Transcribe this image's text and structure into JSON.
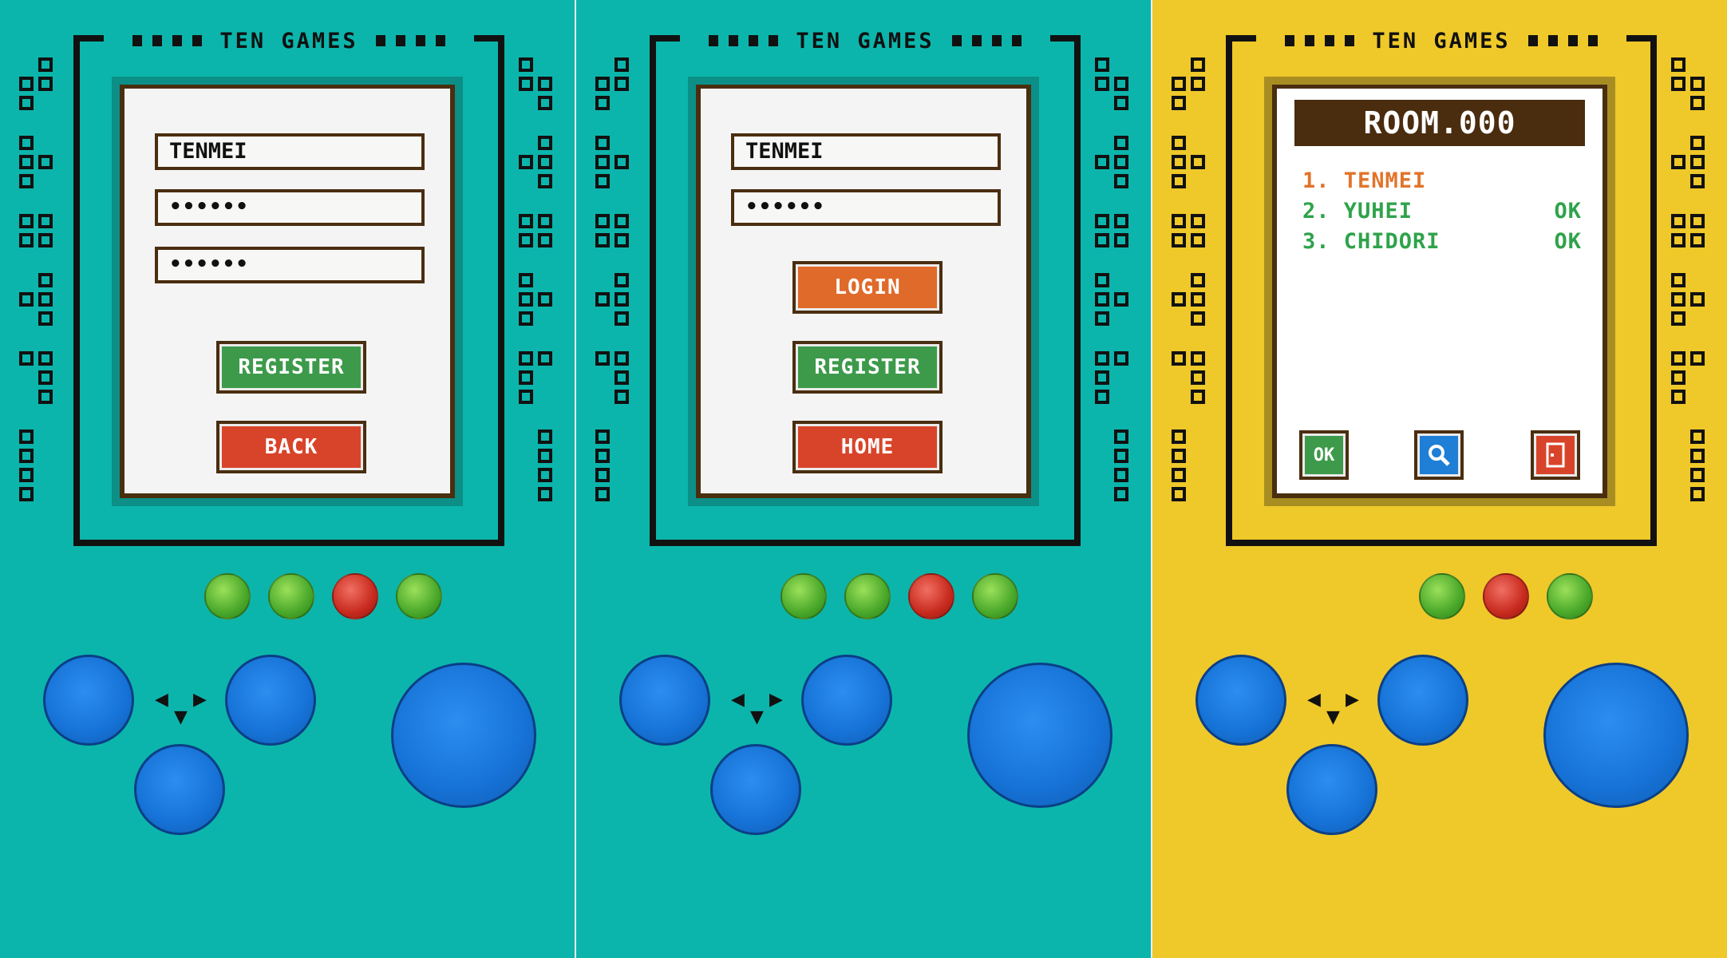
{
  "brand": {
    "title": "TEN GAMES"
  },
  "colors": {
    "teal": "#0cb5ab",
    "yellow": "#efc82a",
    "brown": "#4a2e10",
    "green_btn": "#3d9a4a",
    "red_btn": "#d8442a",
    "orange_btn": "#e06a2a",
    "blue_btn": "#1672d6"
  },
  "register_screen": {
    "username": "TENMEI",
    "password": "••••••",
    "confirm_password": "••••••",
    "register_label": "REGISTER",
    "back_label": "BACK"
  },
  "login_screen": {
    "username": "TENMEI",
    "password": "••••••",
    "login_label": "LOGIN",
    "register_label": "REGISTER",
    "home_label": "HOME"
  },
  "room_screen": {
    "room_title": "ROOM.000",
    "players": [
      {
        "name": "1. TENMEI",
        "status": ""
      },
      {
        "name": "2. YUHEI",
        "status": "OK"
      },
      {
        "name": "3. CHIDORI",
        "status": "OK"
      }
    ],
    "ok_label": "OK",
    "search_icon": "search-icon",
    "exit_icon": "door-exit-icon"
  },
  "indicator_leds": {
    "panel1": [
      "green",
      "green",
      "red",
      "green"
    ],
    "panel2": [
      "green",
      "green",
      "red",
      "green"
    ],
    "panel3": [
      "green",
      "red",
      "green"
    ]
  },
  "dpad_arrows": {
    "left": "◀",
    "right": "▶",
    "down": "▼"
  }
}
